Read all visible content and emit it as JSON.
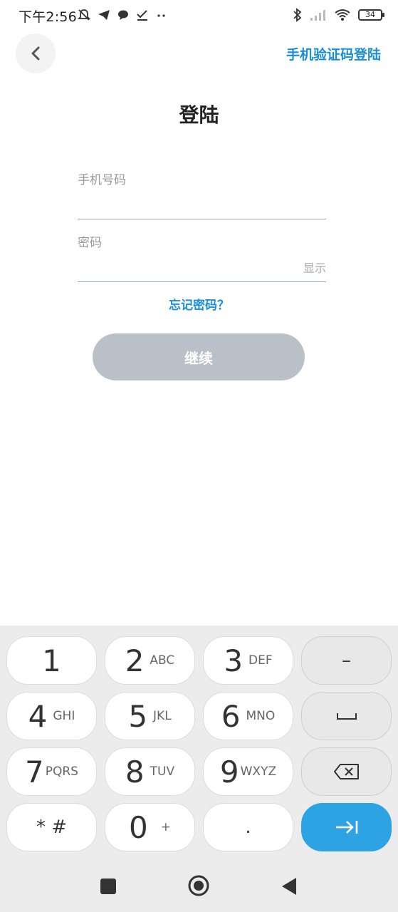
{
  "status": {
    "time": "下午2:56",
    "battery": "34"
  },
  "header": {
    "sms_login": "手机验证码登陆"
  },
  "title": "登陆",
  "form": {
    "phone_label": "手机号码",
    "password_label": "密码",
    "show_toggle": "显示",
    "forgot": "忘记密码？",
    "continue": "继续"
  },
  "keyboard": {
    "rows": [
      [
        {
          "num": "1",
          "sub": ""
        },
        {
          "num": "2",
          "sub": "ABC"
        },
        {
          "num": "3",
          "sub": "DEF"
        },
        {
          "sym": "–"
        }
      ],
      [
        {
          "num": "4",
          "sub": "GHI"
        },
        {
          "num": "5",
          "sub": "JKL"
        },
        {
          "num": "6",
          "sub": "MNO"
        },
        {
          "sym": "space"
        }
      ],
      [
        {
          "num": "7",
          "sub": "PQRS"
        },
        {
          "num": "8",
          "sub": "TUV"
        },
        {
          "num": "9",
          "sub": "WXYZ"
        },
        {
          "sym": "backspace"
        }
      ],
      [
        {
          "num": "* #",
          "sub": ""
        },
        {
          "num": "0",
          "sub": "+"
        },
        {
          "num": ".",
          "sub": ""
        },
        {
          "sym": "next"
        }
      ]
    ],
    "accent_color": "#2ea3e3"
  },
  "colors": {
    "link": "#1a8fd8",
    "button_disabled": "#b9c0c8"
  }
}
